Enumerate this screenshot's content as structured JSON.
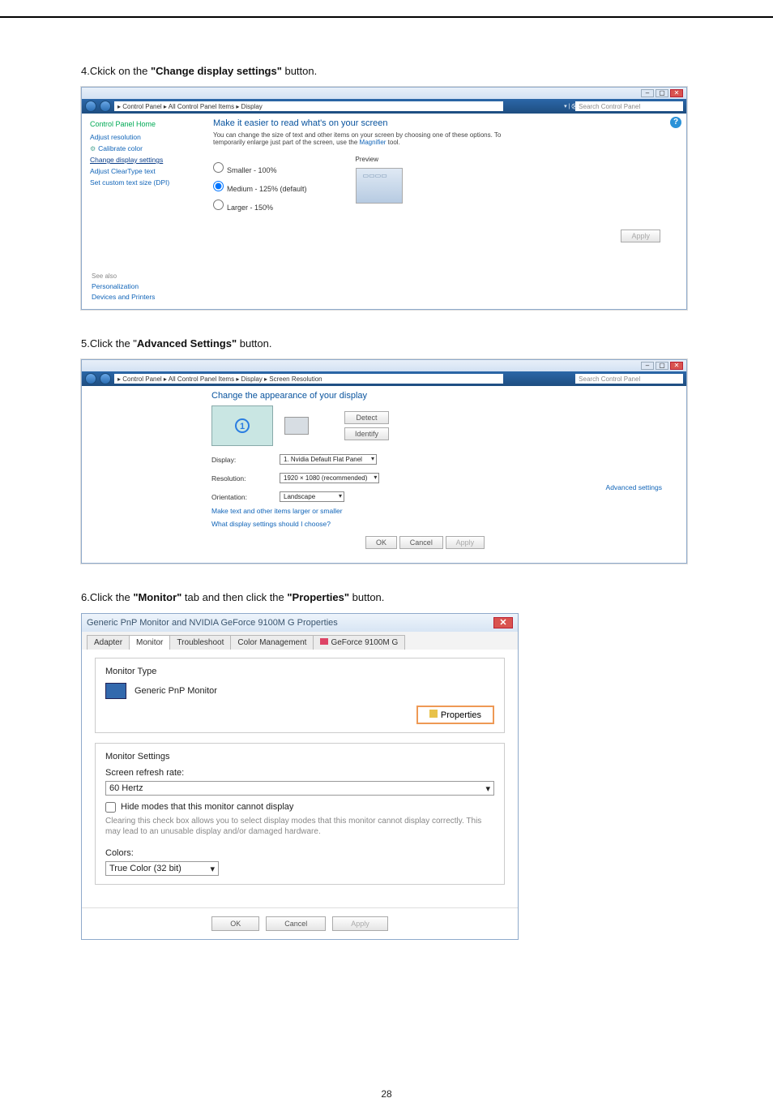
{
  "page_number": "28",
  "steps": {
    "s4": {
      "num": "4.",
      "pre": "Ckick on the ",
      "bold": "\"Change display settings\"",
      "post": " button."
    },
    "s5": {
      "num": "5.",
      "pre": "Click the \"",
      "bold": "Advanced Settings\"",
      "post": " button."
    },
    "s6": {
      "num": "6.",
      "pre": "Click the ",
      "bold1": "\"Monitor\"",
      "mid": " tab and then click the ",
      "bold2": "\"Properties\"",
      "post": " button."
    }
  },
  "win1": {
    "path": "▸ Control Panel ▸ All Control Panel Items ▸ Display",
    "search_placeholder": "Search Control Panel",
    "search_prefix": "▾ | ⨂",
    "help": "?",
    "sidebar": {
      "home": "Control Panel Home",
      "items": [
        "Adjust resolution",
        "Calibrate color",
        "Change display settings",
        "Adjust ClearType text",
        "Set custom text size (DPI)"
      ],
      "see_also_label": "See also",
      "see_also": [
        "Personalization",
        "Devices and Printers"
      ]
    },
    "main": {
      "heading": "Make it easier to read what's on your screen",
      "desc_a": "You can change the size of text and other items on your screen by choosing one of these options. To temporarily enlarge just part of the screen, use the ",
      "magnifier": "Magnifier",
      "desc_b": " tool.",
      "r1": "Smaller - 100%",
      "r2": "Medium - 125% (default)",
      "r3": "Larger - 150%",
      "preview": "Preview",
      "apply": "Apply"
    }
  },
  "win2": {
    "path": "▸ Control Panel ▸ All Control Panel Items ▸ Display ▸ Screen Resolution",
    "search_placeholder": "Search Control Panel",
    "heading": "Change the appearance of your display",
    "circle": "1",
    "detect": "Detect",
    "identify": "Identify",
    "rows": {
      "display_l": "Display:",
      "display_v": "1. Nvidia Default Flat Panel",
      "res_l": "Resolution:",
      "res_v": "1920 × 1080 (recommended)",
      "ori_l": "Orientation:",
      "ori_v": "Landscape"
    },
    "advanced": "Advanced settings",
    "link1": "Make text and other items larger or smaller",
    "link2": "What display settings should I choose?",
    "ok": "OK",
    "cancel": "Cancel",
    "apply": "Apply"
  },
  "dlg": {
    "title": "Generic PnP Monitor and NVIDIA GeForce 9100M G   Properties",
    "tabs": [
      "Adapter",
      "Monitor",
      "Troubleshoot",
      "Color Management",
      "GeForce 9100M G"
    ],
    "grp1": "Monitor Type",
    "monitor_name": "Generic PnP Monitor",
    "properties": "Properties",
    "grp2": "Monitor Settings",
    "refresh_l": "Screen refresh rate:",
    "refresh_v": "60 Hertz",
    "hide": "Hide modes that this monitor cannot display",
    "note": "Clearing this check box allows you to select display modes that this monitor cannot display correctly. This may lead to an unusable display and/or damaged hardware.",
    "colors_l": "Colors:",
    "colors_v": "True Color (32 bit)",
    "ok": "OK",
    "cancel": "Cancel",
    "apply": "Apply"
  }
}
